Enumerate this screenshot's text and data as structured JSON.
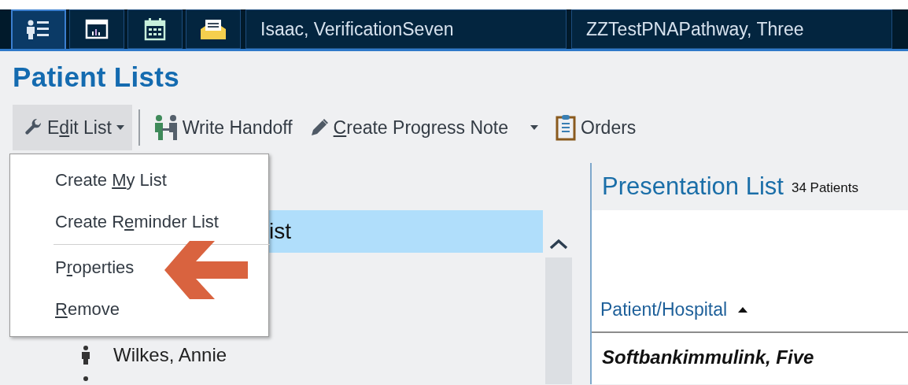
{
  "tab_bar": {
    "icon_tabs": [
      {
        "selected": true
      },
      {
        "selected": false
      },
      {
        "selected": false
      },
      {
        "selected": false
      }
    ],
    "patient_tabs": [
      {
        "label": "Isaac, VerificationSeven",
        "selected": false
      },
      {
        "label": "ZZTestPNAPathway, Three",
        "selected": false
      }
    ]
  },
  "page_title": "Patient Lists",
  "toolbar": {
    "edit_list": {
      "label_parts": {
        "before": "E",
        "key": "d",
        "after": "it List"
      },
      "expanded": true
    },
    "write_handoff": {
      "label": "Write Handoff"
    },
    "create_progress_note": {
      "label_parts": {
        "key": "C",
        "after": "reate Progress Note"
      }
    },
    "orders": {
      "label": "Orders"
    }
  },
  "edit_list_menu": [
    {
      "label_parts": {
        "before": "Create ",
        "key": "M",
        "after": "y List"
      }
    },
    {
      "label_parts": {
        "before": "Create R",
        "key": "e",
        "after": "minder List"
      }
    },
    {
      "label_parts": {
        "before": "P",
        "key": "r",
        "after": "operties"
      },
      "separator_before": true,
      "pointed": true
    },
    {
      "label_parts": {
        "key": "R",
        "after": "emove"
      }
    }
  ],
  "patient_lists": {
    "items": [
      {
        "label": "ist",
        "selected": true
      }
    ],
    "patients": [
      {
        "name": "Wilkes, Annie"
      }
    ]
  },
  "presentation": {
    "title": "Presentation List",
    "count": "34 Patients",
    "columns": [
      {
        "label": "Patient/Hospital",
        "sorted_ascending": true
      }
    ],
    "rows": [
      {
        "patient": "Softbankimmulink, Five"
      }
    ]
  }
}
